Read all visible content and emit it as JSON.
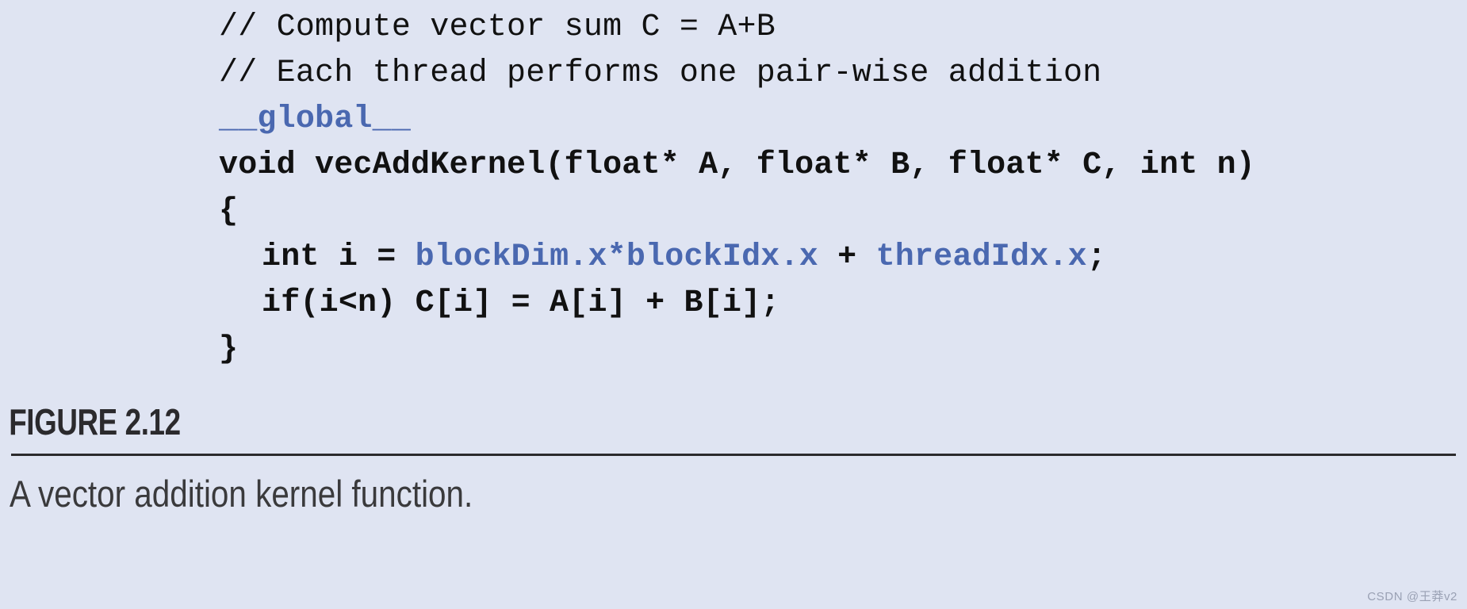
{
  "figure": {
    "background_color": "#dfe4f2",
    "number_label": "FIGURE 2.12",
    "caption": "A vector addition kernel function.",
    "rule_color": "#2b2a2d"
  },
  "code": {
    "language": "CUDA C",
    "comment_color": "#111111",
    "keyword_color": "#4a68b0",
    "text_color": "#111111",
    "lines": [
      {
        "id": "line-1",
        "kind": "comment",
        "text": "// Compute vector sum C = A+B"
      },
      {
        "id": "line-2",
        "kind": "comment",
        "text": "// Each thread performs one pair-wise addition"
      },
      {
        "id": "line-3",
        "kind": "code",
        "text": "__global__",
        "segments": [
          {
            "text": "__global__",
            "style": "blue"
          }
        ]
      },
      {
        "id": "line-4",
        "kind": "code",
        "text": "void vecAddKernel(float* A, float* B, float* C, int n)",
        "segments": [
          {
            "text": "void vecAddKernel(float* A, float* B, float* C, int n)",
            "style": "black"
          }
        ]
      },
      {
        "id": "line-5",
        "kind": "code",
        "text": "{",
        "segments": [
          {
            "text": "{",
            "style": "black"
          }
        ]
      },
      {
        "id": "line-6",
        "kind": "code",
        "text": "int i = blockDim.x*blockIdx.x + threadIdx.x;",
        "segments": [
          {
            "text": "int i = ",
            "style": "black"
          },
          {
            "text": "blockDim.x*blockIdx.x",
            "style": "blue"
          },
          {
            "text": " + ",
            "style": "black"
          },
          {
            "text": "threadIdx.x",
            "style": "blue"
          },
          {
            "text": ";",
            "style": "black"
          }
        ]
      },
      {
        "id": "line-7",
        "kind": "code",
        "text": "if(i<n) C[i] = A[i] + B[i];",
        "segments": [
          {
            "text": "if(i<n) C[i] = A[i] + B[i];",
            "style": "black"
          }
        ]
      },
      {
        "id": "line-8",
        "kind": "code",
        "text": "}",
        "segments": [
          {
            "text": "}",
            "style": "black"
          }
        ]
      }
    ]
  },
  "watermark": {
    "text": "CSDN @王莽v2"
  }
}
